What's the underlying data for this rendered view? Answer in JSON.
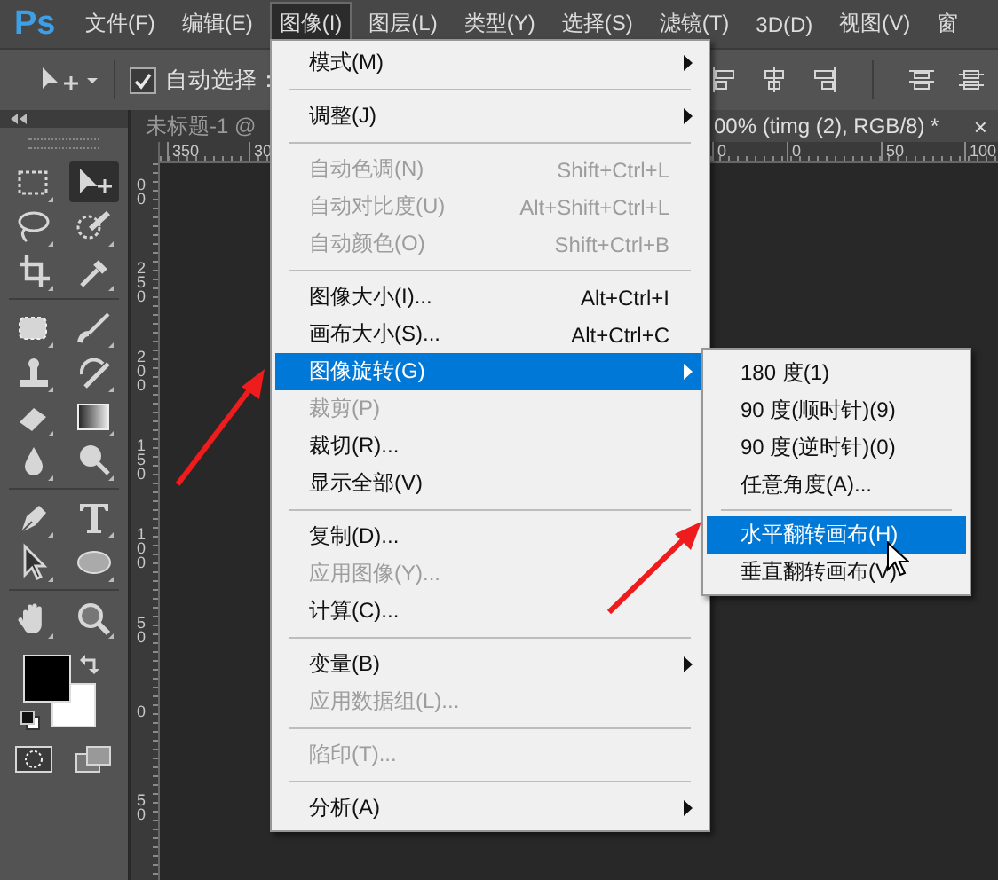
{
  "menubar": {
    "logo": "Ps",
    "items": [
      {
        "label": "文件(F)",
        "selected": false
      },
      {
        "label": "编辑(E)",
        "selected": false
      },
      {
        "label": "图像(I)",
        "selected": true
      },
      {
        "label": "图层(L)",
        "selected": false
      },
      {
        "label": "类型(Y)",
        "selected": false
      },
      {
        "label": "选择(S)",
        "selected": false
      },
      {
        "label": "滤镜(T)",
        "selected": false
      },
      {
        "label": "3D(D)",
        "selected": false
      },
      {
        "label": "视图(V)",
        "selected": false
      },
      {
        "label": "窗",
        "selected": false
      }
    ]
  },
  "options_bar": {
    "auto_select": {
      "label": "自动选择：",
      "checked": true
    }
  },
  "tools": [
    {
      "selected": false
    },
    {
      "selected": true
    },
    {
      "selected": false
    },
    {
      "selected": false
    },
    {
      "selected": false
    },
    {
      "selected": false
    },
    {
      "selected": false
    },
    {
      "selected": false
    },
    {
      "selected": false
    },
    {
      "selected": false
    },
    {
      "selected": false
    },
    {
      "selected": false
    },
    {
      "selected": false
    },
    {
      "selected": false
    },
    {
      "selected": false
    },
    {
      "selected": false
    },
    {
      "selected": false
    },
    {
      "selected": false
    },
    {
      "selected": false
    },
    {
      "selected": false
    }
  ],
  "document_tabs": [
    {
      "title": "未标题-1 @",
      "selected": false
    },
    {
      "title": "00% (timg (2), RGB/8) *",
      "selected": true,
      "close": "×"
    }
  ],
  "horizontal_ruler": [
    "350",
    "30",
    "0",
    "0",
    "50",
    "100"
  ],
  "vertical_ruler": [
    "00",
    "250",
    "200",
    "150",
    "100",
    "50",
    "0",
    "50"
  ],
  "image_menu": {
    "items": [
      {
        "kind": "item",
        "label": "模式(M)",
        "submenu": true,
        "disabled": false,
        "selected": false
      },
      {
        "kind": "separator"
      },
      {
        "kind": "item",
        "label": "调整(J)",
        "submenu": true,
        "disabled": false,
        "selected": false
      },
      {
        "kind": "separator"
      },
      {
        "kind": "item",
        "label": "自动色调(N)",
        "shortcut": "Shift+Ctrl+L",
        "submenu": false,
        "disabled": true,
        "selected": false
      },
      {
        "kind": "item",
        "label": "自动对比度(U)",
        "shortcut": "Alt+Shift+Ctrl+L",
        "submenu": false,
        "disabled": true,
        "selected": false
      },
      {
        "kind": "item",
        "label": "自动颜色(O)",
        "shortcut": "Shift+Ctrl+B",
        "submenu": false,
        "disabled": true,
        "selected": false
      },
      {
        "kind": "separator"
      },
      {
        "kind": "item",
        "label": "图像大小(I)...",
        "shortcut": "Alt+Ctrl+I",
        "submenu": false,
        "disabled": false,
        "selected": false
      },
      {
        "kind": "item",
        "label": "画布大小(S)...",
        "shortcut": "Alt+Ctrl+C",
        "submenu": false,
        "disabled": false,
        "selected": false
      },
      {
        "kind": "item",
        "label": "图像旋转(G)",
        "submenu": true,
        "disabled": false,
        "selected": true
      },
      {
        "kind": "item",
        "label": "裁剪(P)",
        "submenu": false,
        "disabled": true,
        "selected": false
      },
      {
        "kind": "item",
        "label": "裁切(R)...",
        "submenu": false,
        "disabled": false,
        "selected": false
      },
      {
        "kind": "item",
        "label": "显示全部(V)",
        "submenu": false,
        "disabled": false,
        "selected": false
      },
      {
        "kind": "separator"
      },
      {
        "kind": "item",
        "label": "复制(D)...",
        "submenu": false,
        "disabled": false,
        "selected": false
      },
      {
        "kind": "item",
        "label": "应用图像(Y)...",
        "submenu": false,
        "disabled": true,
        "selected": false
      },
      {
        "kind": "item",
        "label": "计算(C)...",
        "submenu": false,
        "disabled": false,
        "selected": false
      },
      {
        "kind": "separator"
      },
      {
        "kind": "item",
        "label": "变量(B)",
        "submenu": true,
        "disabled": false,
        "selected": false
      },
      {
        "kind": "item",
        "label": "应用数据组(L)...",
        "submenu": false,
        "disabled": true,
        "selected": false
      },
      {
        "kind": "separator"
      },
      {
        "kind": "item",
        "label": "陷印(T)...",
        "submenu": false,
        "disabled": true,
        "selected": false
      },
      {
        "kind": "separator"
      },
      {
        "kind": "item",
        "label": "分析(A)",
        "submenu": true,
        "disabled": false,
        "selected": false
      }
    ]
  },
  "rotate_submenu": {
    "items": [
      {
        "kind": "item",
        "label": "180 度(1)",
        "selected": false
      },
      {
        "kind": "item",
        "label": "90 度(顺时针)(9)",
        "selected": false
      },
      {
        "kind": "item",
        "label": "90 度(逆时针)(0)",
        "selected": false
      },
      {
        "kind": "item",
        "label": "任意角度(A)...",
        "selected": false
      },
      {
        "kind": "separator"
      },
      {
        "kind": "item",
        "label": "水平翻转画布(H)",
        "selected": true
      },
      {
        "kind": "item",
        "label": "垂直翻转画布(V)",
        "selected": false
      }
    ]
  }
}
